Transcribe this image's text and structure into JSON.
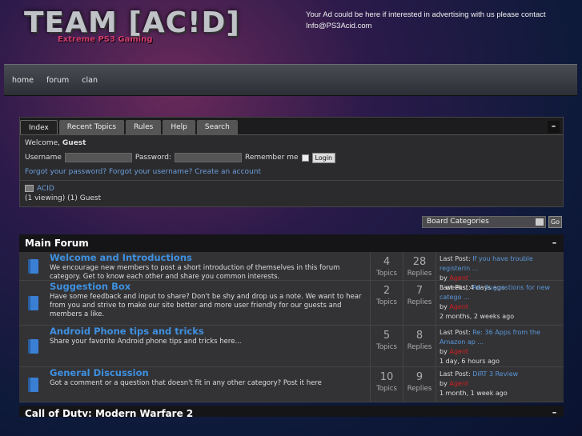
{
  "header": {
    "logo_title": "TEAM [AC!D]",
    "logo_subtitle": "Extreme PS3 Gaming",
    "ad_text": "Your Ad could be here if interested in advertising with us please contact Info@PS3Acid.com"
  },
  "nav": [
    "home",
    "forum",
    "clan"
  ],
  "tabs": [
    "Index",
    "Recent Topics",
    "Rules",
    "Help",
    "Search"
  ],
  "login": {
    "welcome_prefix": "Welcome,",
    "guest": "Guest",
    "username_label": "Username",
    "password_label": "Password:",
    "remember_label": "Remember me",
    "login_button": "Login",
    "forgot_password": "Forgot your password?",
    "forgot_username": "Forgot your username?",
    "create_account": "Create an account"
  },
  "online": {
    "group": "ACID",
    "viewing": "(1 viewing) (1) Guest"
  },
  "board_select": {
    "selected": "Board Categories",
    "go": "Go"
  },
  "categories": [
    {
      "title": "Main Forum",
      "forums": [
        {
          "title": "Welcome and Introductions",
          "desc": "We encourage new members to post a short introduction of themselves in this forum category. Get to know each other and share you common interests.",
          "topics": "4",
          "replies": "28",
          "last_post_link": "If you have trouble registerin ...",
          "last_user": "Agent",
          "last_time": "3 weeks, 4 days ago"
        },
        {
          "title": "Suggestion Box",
          "desc": "Have some feedback and input to share? Don't be shy and drop us a note. We want to hear from you and strive to make our site better and more user friendly for our guests and members a like.",
          "topics": "2",
          "replies": "7",
          "last_post_link": "Re: Suggestions for new catego ...",
          "last_user": "Agent",
          "last_time": "2 months, 2 weeks ago"
        },
        {
          "title": "Android Phone tips and tricks",
          "desc": "Share your favorite Android phone tips and tricks here...",
          "topics": "5",
          "replies": "8",
          "last_post_link": "Re: 36 Apps from the Amazon ap ...",
          "last_user": "Agent",
          "last_time": "1 day, 6 hours ago"
        },
        {
          "title": "General Discussion",
          "desc": "Got a comment or a question that doesn't fit in any other category? Post it here",
          "topics": "10",
          "replies": "9",
          "last_post_link": "DiRT 3 Review",
          "last_user": "Agent",
          "last_time": "1 month, 1 week ago"
        }
      ]
    },
    {
      "title": "Call of Duty: Modern Warfare 2"
    }
  ],
  "labels": {
    "topics": "Topics",
    "replies": "Replies",
    "last_post": "Last Post:",
    "by": "by"
  }
}
